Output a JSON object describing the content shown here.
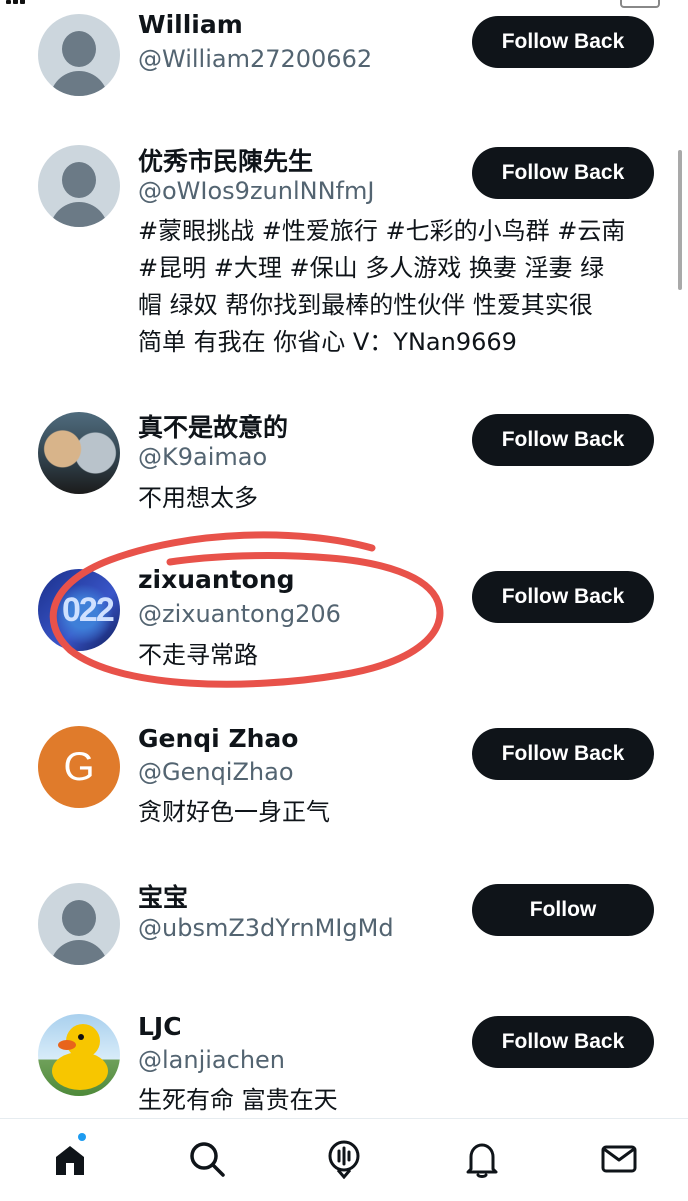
{
  "users": [
    {
      "name": "William",
      "handle": "@William27200662",
      "bio": [],
      "button": "Follow Back",
      "avatar": "default-avatar"
    },
    {
      "name": "优秀市民陳先生",
      "handle": "@oWIos9zunlNNfmJ",
      "bio": [
        "#蒙眼挑战 #性爱旅行 #七彩的小鸟群 #云南",
        "#昆明 #大理 #保山 多人游戏 换妻 淫妻 绿",
        "帽 绿奴 帮你找到最棒的性伙伴 性爱其实很",
        "简单 有我在 你省心 V：YNan9669"
      ],
      "button": "Follow Back",
      "avatar": "default-avatar"
    },
    {
      "name": "真不是故意的",
      "handle": "@K9aimao",
      "bio": [
        "不用想太多"
      ],
      "button": "Follow Back",
      "avatar": "dogs-photo-avatar"
    },
    {
      "name": "zixuantong",
      "handle": "@zixuantong206",
      "bio": [
        "不走寻常路"
      ],
      "button": "Follow Back",
      "avatar": "2022-avatar",
      "avatar_text": "022"
    },
    {
      "name": "Genqi Zhao",
      "handle": "@GenqiZhao",
      "bio": [
        "贪财好色一身正气"
      ],
      "button": "Follow Back",
      "avatar": "letter-avatar",
      "avatar_letter": "G"
    },
    {
      "name": "宝宝",
      "handle": "@ubsmZ3dYrnMIgMd",
      "bio": [],
      "button": "Follow",
      "avatar": "default-avatar"
    },
    {
      "name": "LJC",
      "handle": "@lanjiachen",
      "bio": [
        "生死有命 富贵在天"
      ],
      "button": "Follow Back",
      "avatar": "duck-avatar"
    }
  ],
  "tabbar": {
    "items": [
      "home-icon",
      "search-icon",
      "spaces-icon",
      "notifications-icon",
      "messages-icon"
    ],
    "home_badge_color": "#1d9bf0"
  },
  "colors": {
    "button_bg": "#0f1419",
    "handle": "#536471",
    "annotation_circle": "#e8524a"
  }
}
